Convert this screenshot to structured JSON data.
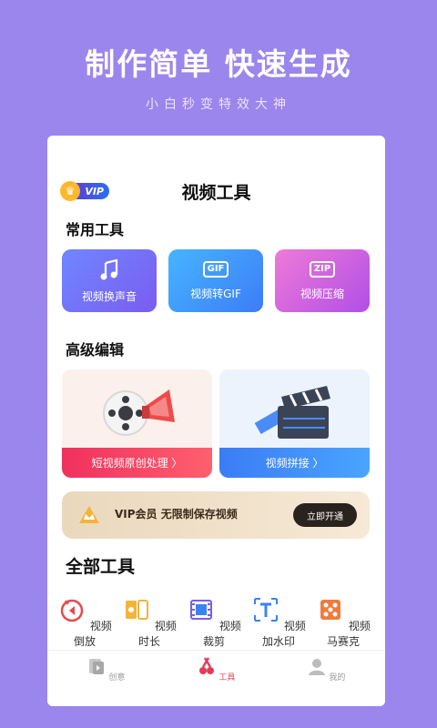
{
  "hero": {
    "title": "制作简单 快速生成",
    "subtitle": "小白秒变特效大神"
  },
  "header": {
    "vip_badge": "VIP",
    "title": "视频工具"
  },
  "common_tools": {
    "title": "常用工具",
    "items": [
      {
        "label": "视频换声音",
        "icon": "music-note-icon"
      },
      {
        "label": "视频转GIF",
        "icon": "gif-icon",
        "icon_text": "GIF"
      },
      {
        "label": "视频压缩",
        "icon": "zip-icon",
        "icon_text": "ZIP"
      }
    ]
  },
  "advanced": {
    "title": "高级编辑",
    "items": [
      {
        "label": "短视频原创处理 〉",
        "icon": "film-reel-megaphone-icon"
      },
      {
        "label": "视频拼接 〉",
        "icon": "clapperboard-icon"
      }
    ]
  },
  "vip_promo": {
    "text": "VIP会员 无限制保存视频",
    "button": "立即开通"
  },
  "all_tools": {
    "title": "全部工具",
    "items": [
      {
        "label": "视频倒放",
        "icon": "rewind-icon"
      },
      {
        "label": "视频时长",
        "icon": "duration-icon"
      },
      {
        "label": "视频裁剪",
        "icon": "crop-icon"
      },
      {
        "label": "视频加水印",
        "icon": "watermark-text-icon"
      },
      {
        "label": "视频马赛克",
        "icon": "mosaic-icon"
      }
    ]
  },
  "tabbar": {
    "items": [
      {
        "label": "创意",
        "icon": "creative-icon",
        "active": false
      },
      {
        "label": "工具",
        "icon": "tools-icon",
        "active": true
      },
      {
        "label": "我的",
        "icon": "profile-icon",
        "active": false
      }
    ]
  },
  "colors": {
    "background": "#9a86ec",
    "active_tab": "#e23c5b",
    "vip_button": "#2a221d"
  }
}
